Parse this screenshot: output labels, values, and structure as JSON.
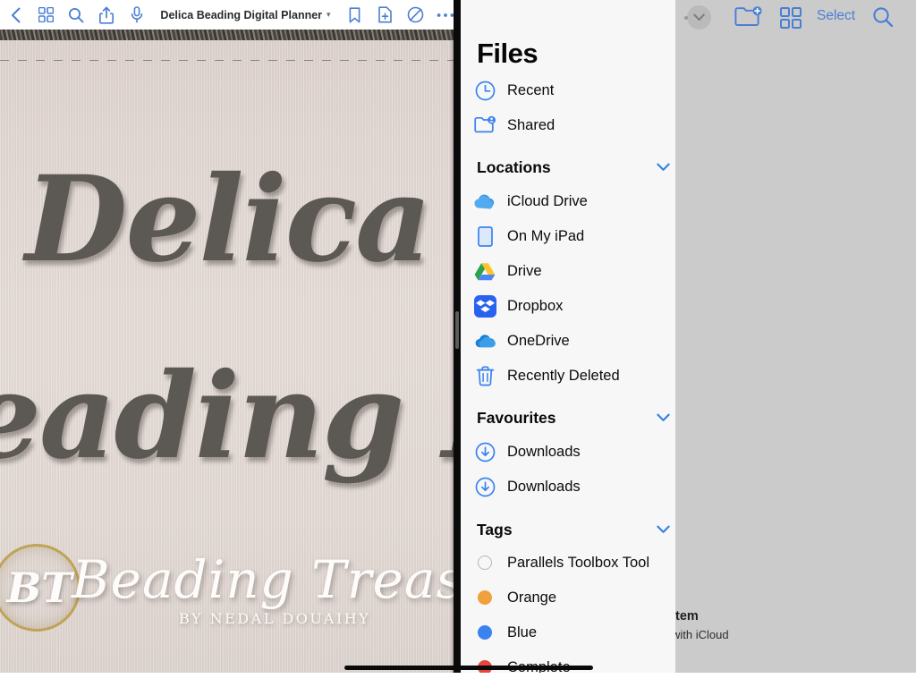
{
  "books_app": {
    "toolbar": {
      "back_icon": "chevron-left-icon",
      "library_icon": "grid-icon",
      "search_icon": "search-icon",
      "share_icon": "share-icon",
      "audio_icon": "microphone-icon",
      "title": "Delica Beading Digital Planner",
      "title_chevron": "chevron-down-icon",
      "bookmark_icon": "bookmark-icon",
      "add_page_icon": "add-page-icon",
      "markup_icon": "markup-icon",
      "more_icon": "ellipsis-icon"
    },
    "cover": {
      "line1": "Delica",
      "line2": "eading Plan",
      "monogram": "BT",
      "brand": "Beading Treasures",
      "byline": "BY NEDAL DOUAIHY"
    }
  },
  "files_app": {
    "toolbar": {
      "more_icon": "circled-ellipsis-icon",
      "collapse_icon": "chevron-down-circle-icon",
      "new_folder_icon": "new-folder-icon",
      "view_grid_icon": "grid-view-icon",
      "select_label": "Select",
      "search_icon": "search-icon"
    },
    "status": {
      "count": "item",
      "sync": "with iCloud"
    },
    "sidebar": {
      "title": "Files",
      "top_items": [
        {
          "label": "Recent",
          "icon": "clock-icon"
        },
        {
          "label": "Shared",
          "icon": "shared-folder-icon"
        }
      ],
      "locations_header": "Locations",
      "locations": [
        {
          "label": "iCloud Drive",
          "icon": "icloud-icon"
        },
        {
          "label": "On My iPad",
          "icon": "ipad-icon"
        },
        {
          "label": "Drive",
          "icon": "google-drive-icon"
        },
        {
          "label": "Dropbox",
          "icon": "dropbox-icon"
        },
        {
          "label": "OneDrive",
          "icon": "onedrive-icon"
        },
        {
          "label": "Recently Deleted",
          "icon": "trash-icon"
        }
      ],
      "favourites_header": "Favourites",
      "favourites": [
        {
          "label": "Downloads",
          "icon": "download-circle-icon"
        },
        {
          "label": "Downloads",
          "icon": "download-circle-icon"
        }
      ],
      "tags_header": "Tags",
      "tags": [
        {
          "label": "Parallels Toolbox Tool",
          "color": "#ffffff"
        },
        {
          "label": "Orange",
          "color": "#f0a03c"
        },
        {
          "label": "Blue",
          "color": "#3a82f0"
        },
        {
          "label": "Complete",
          "color": "#e8453c"
        }
      ]
    }
  },
  "colors": {
    "accent_blue": "#4a7fd4",
    "sidebar_bg": "#f7f7f7",
    "dim_overlay": "#cbcbcb",
    "gold": "#c0a356"
  }
}
